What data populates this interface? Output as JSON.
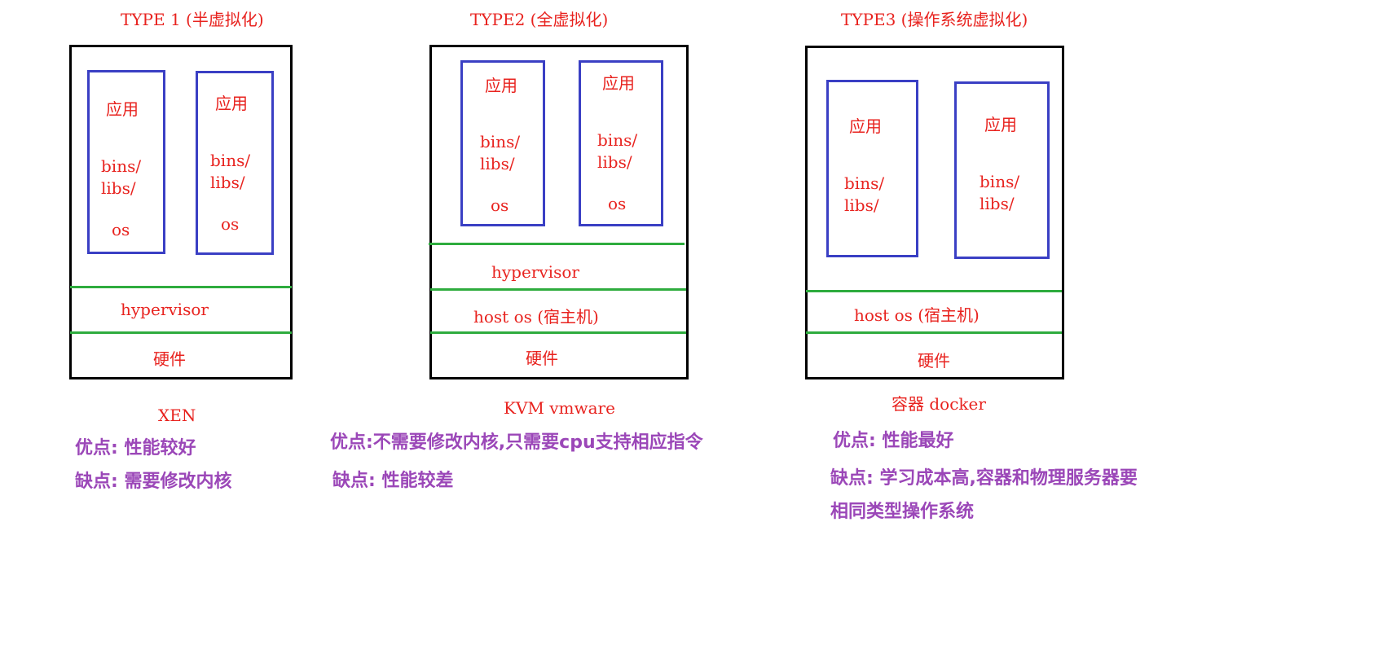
{
  "type1": {
    "title": "TYPE 1 (半虚拟化)",
    "vm": {
      "app": "应用",
      "bins": "bins/",
      "libs": "libs/",
      "os": "os"
    },
    "hypervisor": "hypervisor",
    "hardware": "硬件",
    "product": "XEN",
    "pros": "优点: 性能较好",
    "cons": "缺点: 需要修改内核"
  },
  "type2": {
    "title": "TYPE2 (全虚拟化)",
    "vm": {
      "app": "应用",
      "bins": "bins/",
      "libs": "libs/",
      "os": "os"
    },
    "hypervisor": "hypervisor",
    "host_os": "host os (宿主机)",
    "hardware": "硬件",
    "product": "KVM vmware",
    "pros": "优点:不需要修改内核,只需要cpu支持相应指令",
    "cons": "缺点: 性能较差"
  },
  "type3": {
    "title": "TYPE3 (操作系统虚拟化)",
    "container": {
      "app": "应用",
      "bins": "bins/",
      "libs": "libs/"
    },
    "host_os": "host os (宿主机)",
    "hardware": "硬件",
    "product": "容器 docker",
    "pros": "优点: 性能最好",
    "cons_line1": "缺点: 学习成本高,容器和物理服务器要",
    "cons_line2": "相同类型操作系统"
  },
  "colors": {
    "label": "#e8231f",
    "note": "#9b47b8",
    "vm_border": "#3a3fc4",
    "layer_line": "#2eac3e",
    "outer_border": "#000000"
  }
}
